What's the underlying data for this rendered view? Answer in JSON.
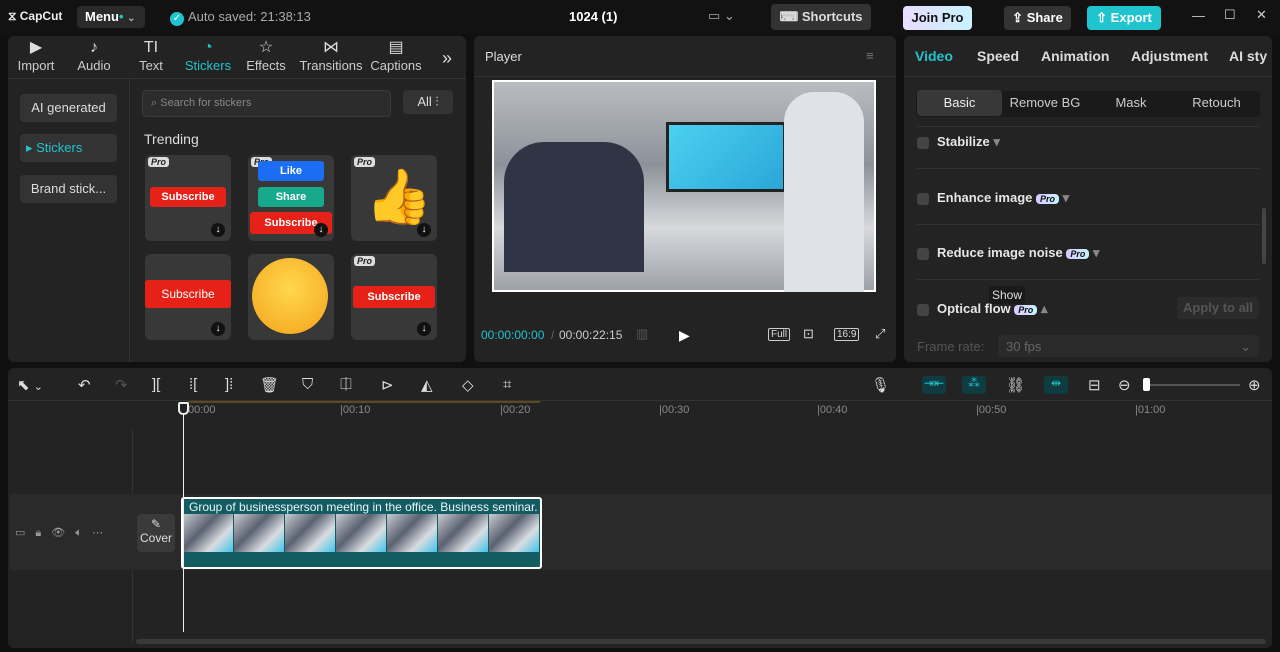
{
  "app": {
    "logo": "CapCut",
    "menu": "Menu",
    "autosave": "Auto saved: 21:38:13",
    "project_title": "1024 (1)",
    "shortcuts": "Shortcuts",
    "join_pro": "Join Pro",
    "share": "Share",
    "export": "Export",
    "accent": "#20c4cf"
  },
  "media_tabs": [
    {
      "label": "Import",
      "icon": "import-icon"
    },
    {
      "label": "Audio",
      "icon": "audio-icon"
    },
    {
      "label": "Text",
      "icon": "text-icon"
    },
    {
      "label": "Stickers",
      "icon": "stickers-icon",
      "active": true
    },
    {
      "label": "Effects",
      "icon": "effects-icon"
    },
    {
      "label": "Transitions",
      "icon": "transitions-icon"
    },
    {
      "label": "Captions",
      "icon": "captions-icon"
    }
  ],
  "sticker_sidebar": [
    "AI generated",
    "Stickers",
    "Brand stick..."
  ],
  "stickers": {
    "search_placeholder": "Search for stickers",
    "filter": "All",
    "section": "Trending",
    "items": [
      {
        "pro": "Pro",
        "text": "Subscribe"
      },
      {
        "pro": "Pro",
        "like": "Like",
        "share": "Share",
        "subscribe": "Subscribe"
      },
      {
        "pro": "Pro"
      },
      {
        "text": "Subscribe"
      },
      {},
      {
        "pro": "Pro",
        "text": "Subscribe"
      }
    ]
  },
  "player": {
    "title": "Player",
    "current_time": "00:00:00:00",
    "total_time": "00:00:22:15",
    "full": "Full",
    "ratio": "16:9"
  },
  "inspector": {
    "tabs": [
      "Video",
      "Speed",
      "Animation",
      "Adjustment",
      "AI styli"
    ],
    "subtabs": [
      "Basic",
      "Remove BG",
      "Mask",
      "Retouch"
    ],
    "options": [
      {
        "label": "Stabilize"
      },
      {
        "label": "Enhance image",
        "pro": "Pro"
      },
      {
        "label": "Reduce image noise",
        "pro": "Pro"
      },
      {
        "label": "Optical flow",
        "pro": "Pro"
      }
    ],
    "tooltip": "Show",
    "apply_all": "Apply to all",
    "frame_rate_label": "Frame rate:",
    "frame_rate_value": "30 fps"
  },
  "timeline": {
    "ticks": [
      "00:00",
      "|00:10",
      "|00:20",
      "|00:30",
      "|00:40",
      "|00:50",
      "|01:00"
    ],
    "cover": "Cover",
    "clip_title": "Group of businessperson meeting in the office. Business seminar."
  }
}
